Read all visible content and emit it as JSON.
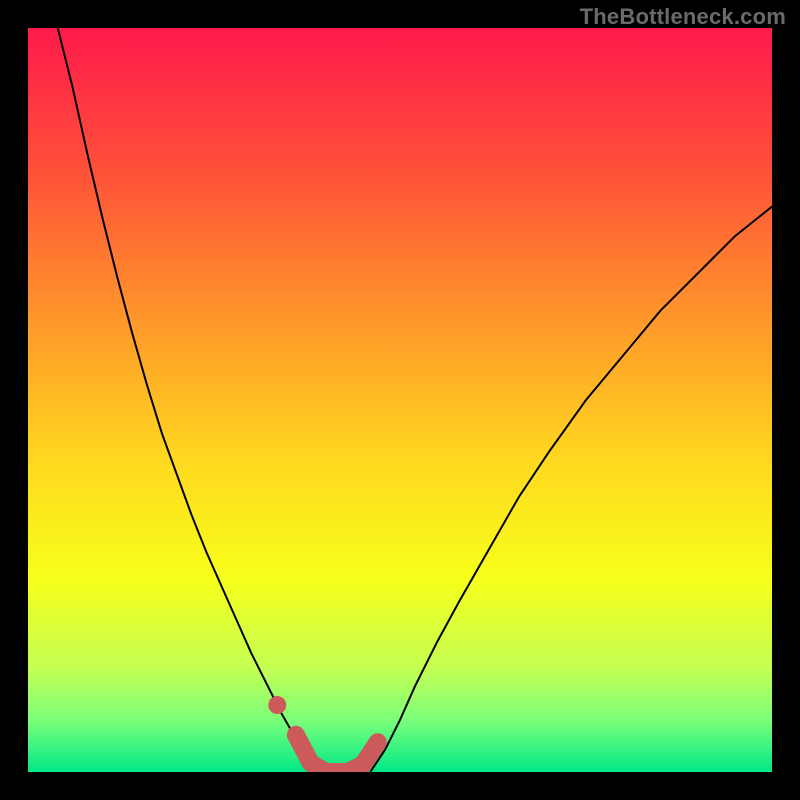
{
  "watermark": "TheBottleneck.com",
  "chart_data": {
    "type": "line",
    "title": "",
    "xlabel": "",
    "ylabel": "",
    "xlim": [
      0,
      1
    ],
    "ylim": [
      0,
      1
    ],
    "grid": false,
    "legend": false,
    "background": {
      "gradient_stops": [
        {
          "offset": 0.0,
          "color": "#ff1a4c"
        },
        {
          "offset": 0.18,
          "color": "#ff4d3a"
        },
        {
          "offset": 0.4,
          "color": "#ff9a2a"
        },
        {
          "offset": 0.58,
          "color": "#ffd81f"
        },
        {
          "offset": 0.74,
          "color": "#f7ff1a"
        },
        {
          "offset": 0.86,
          "color": "#c4ff52"
        },
        {
          "offset": 0.93,
          "color": "#7cff7a"
        },
        {
          "offset": 1.0,
          "color": "#00e887"
        }
      ]
    },
    "series": [
      {
        "name": "curve-left",
        "stroke": "#000000",
        "stroke_width": 2,
        "points": [
          {
            "x": 0.04,
            "y": 1.0
          },
          {
            "x": 0.06,
            "y": 0.92
          },
          {
            "x": 0.08,
            "y": 0.83
          },
          {
            "x": 0.1,
            "y": 0.745
          },
          {
            "x": 0.12,
            "y": 0.665
          },
          {
            "x": 0.14,
            "y": 0.59
          },
          {
            "x": 0.16,
            "y": 0.52
          },
          {
            "x": 0.18,
            "y": 0.455
          },
          {
            "x": 0.2,
            "y": 0.4
          },
          {
            "x": 0.22,
            "y": 0.345
          },
          {
            "x": 0.24,
            "y": 0.295
          },
          {
            "x": 0.26,
            "y": 0.25
          },
          {
            "x": 0.28,
            "y": 0.205
          },
          {
            "x": 0.3,
            "y": 0.16
          },
          {
            "x": 0.32,
            "y": 0.12
          },
          {
            "x": 0.34,
            "y": 0.08
          },
          {
            "x": 0.36,
            "y": 0.045
          },
          {
            "x": 0.38,
            "y": 0.012
          },
          {
            "x": 0.39,
            "y": 0.0
          }
        ]
      },
      {
        "name": "curve-right",
        "stroke": "#000000",
        "stroke_width": 2,
        "points": [
          {
            "x": 0.46,
            "y": 0.0
          },
          {
            "x": 0.48,
            "y": 0.03
          },
          {
            "x": 0.5,
            "y": 0.07
          },
          {
            "x": 0.52,
            "y": 0.115
          },
          {
            "x": 0.55,
            "y": 0.175
          },
          {
            "x": 0.58,
            "y": 0.23
          },
          {
            "x": 0.62,
            "y": 0.3
          },
          {
            "x": 0.66,
            "y": 0.37
          },
          {
            "x": 0.7,
            "y": 0.43
          },
          {
            "x": 0.75,
            "y": 0.5
          },
          {
            "x": 0.8,
            "y": 0.56
          },
          {
            "x": 0.85,
            "y": 0.62
          },
          {
            "x": 0.9,
            "y": 0.67
          },
          {
            "x": 0.95,
            "y": 0.72
          },
          {
            "x": 1.0,
            "y": 0.76
          }
        ]
      },
      {
        "name": "highlight-valley",
        "stroke": "#cc5a5a",
        "stroke_width": 18,
        "linecap": "round",
        "points": [
          {
            "x": 0.36,
            "y": 0.05
          },
          {
            "x": 0.38,
            "y": 0.012
          },
          {
            "x": 0.4,
            "y": 0.0
          },
          {
            "x": 0.43,
            "y": 0.0
          },
          {
            "x": 0.45,
            "y": 0.01
          },
          {
            "x": 0.47,
            "y": 0.04
          }
        ]
      }
    ],
    "markers": [
      {
        "name": "highlight-dot",
        "x": 0.335,
        "y": 0.09,
        "r": 9,
        "fill": "#cc5a5a"
      }
    ]
  }
}
